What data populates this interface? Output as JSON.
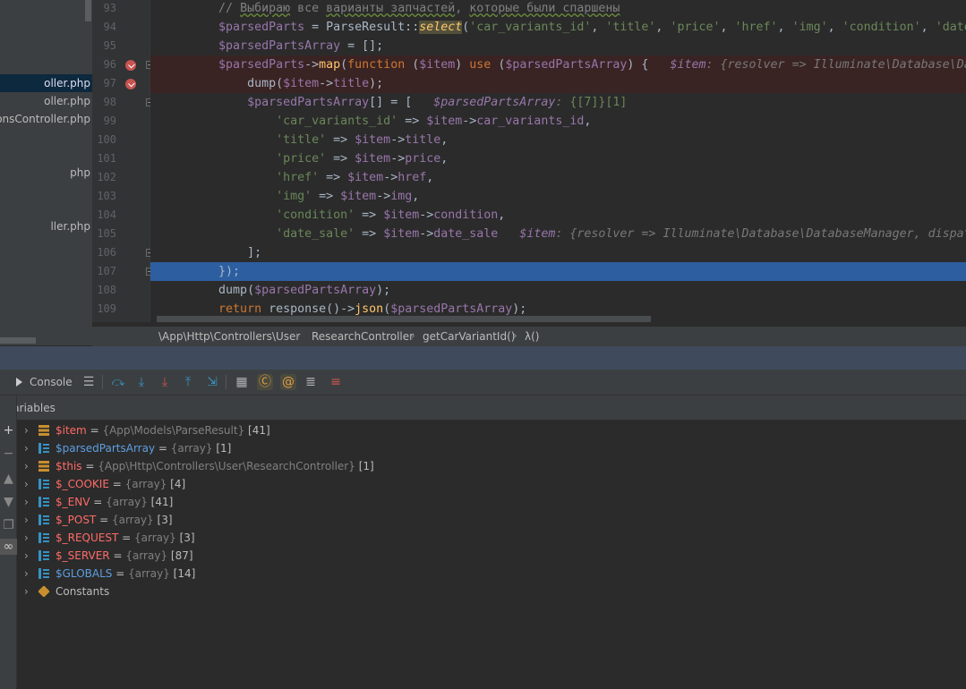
{
  "project_tree": {
    "items": [
      {
        "label": "oller.php",
        "selected": true
      },
      {
        "label": "oller.php",
        "selected": false
      },
      {
        "label": "ionsController.php",
        "selected": false
      },
      {
        "label": "php",
        "selected": false
      },
      {
        "label": "ller.php",
        "selected": false
      }
    ]
  },
  "editor": {
    "lines": [
      {
        "num": "93",
        "tokens": [
          [
            "c",
            "        // "
          ],
          [
            "c ru",
            "Выбираю"
          ],
          [
            "c",
            " все "
          ],
          [
            "c ru",
            "варианты запчастей"
          ],
          [
            "c",
            ", "
          ],
          [
            "c ru",
            "которые были спаршены"
          ]
        ]
      },
      {
        "num": "94",
        "tokens": [
          [
            "v",
            "        $parsedParts"
          ],
          [
            "cls",
            " = ParseResult::"
          ],
          [
            "sel",
            "select"
          ],
          [
            "cls",
            "("
          ],
          [
            "s",
            "'car_variants_id'"
          ],
          [
            "cls",
            ", "
          ],
          [
            "s",
            "'title'"
          ],
          [
            "cls",
            ", "
          ],
          [
            "s",
            "'price'"
          ],
          [
            "cls",
            ", "
          ],
          [
            "s",
            "'href'"
          ],
          [
            "cls",
            ", "
          ],
          [
            "s",
            "'img'"
          ],
          [
            "cls",
            ", "
          ],
          [
            "s",
            "'condition'"
          ],
          [
            "cls",
            ", "
          ],
          [
            "s",
            "'date_"
          ]
        ]
      },
      {
        "num": "95",
        "tokens": [
          [
            "v",
            "        $parsedPartsArray"
          ],
          [
            "cls",
            " = [];"
          ]
        ]
      },
      {
        "num": "96",
        "tokens": [
          [
            "v",
            "        $parsedParts"
          ],
          [
            "cls",
            "->"
          ],
          [
            "f",
            "map"
          ],
          [
            "cls",
            "("
          ],
          [
            "k",
            "function"
          ],
          [
            "cls",
            " ("
          ],
          [
            "v",
            "$item"
          ],
          [
            "cls",
            ") "
          ],
          [
            "k",
            "use"
          ],
          [
            "cls",
            " ("
          ],
          [
            "v",
            "$parsedPartsArray"
          ],
          [
            "cls",
            ") {   "
          ],
          [
            "hv",
            "$item"
          ],
          [
            "h",
            ": {resolver => Illuminate\\Database\\Dat"
          ]
        ]
      },
      {
        "num": "97",
        "tokens": [
          [
            "cls",
            "            dump("
          ],
          [
            "v",
            "$item"
          ],
          [
            "cls",
            "->"
          ],
          [
            "v",
            "title"
          ],
          [
            "cls",
            ");"
          ]
        ]
      },
      {
        "num": "98",
        "tokens": [
          [
            "v",
            "            $parsedPartsArray"
          ],
          [
            "cls",
            "[] = [   "
          ],
          [
            "hv",
            "$parsedPartsArray"
          ],
          [
            "h",
            ": "
          ],
          [
            "s",
            "{[7]}[1]"
          ]
        ]
      },
      {
        "num": "99",
        "tokens": [
          [
            "s",
            "                'car_variants_id'"
          ],
          [
            "cls",
            " => "
          ],
          [
            "v",
            "$item"
          ],
          [
            "cls",
            "->"
          ],
          [
            "v",
            "car_variants_id"
          ],
          [
            "cls",
            ","
          ]
        ]
      },
      {
        "num": "100",
        "tokens": [
          [
            "s",
            "                'title'"
          ],
          [
            "cls",
            " => "
          ],
          [
            "v",
            "$item"
          ],
          [
            "cls",
            "->"
          ],
          [
            "v",
            "title"
          ],
          [
            "cls",
            ","
          ]
        ]
      },
      {
        "num": "101",
        "tokens": [
          [
            "s",
            "                'price'"
          ],
          [
            "cls",
            " => "
          ],
          [
            "v",
            "$item"
          ],
          [
            "cls",
            "->"
          ],
          [
            "v",
            "price"
          ],
          [
            "cls",
            ","
          ]
        ]
      },
      {
        "num": "102",
        "tokens": [
          [
            "s",
            "                'href'"
          ],
          [
            "cls",
            " => "
          ],
          [
            "v",
            "$item"
          ],
          [
            "cls",
            "->"
          ],
          [
            "v",
            "href"
          ],
          [
            "cls",
            ","
          ]
        ]
      },
      {
        "num": "103",
        "tokens": [
          [
            "s",
            "                'img'"
          ],
          [
            "cls",
            " => "
          ],
          [
            "v",
            "$item"
          ],
          [
            "cls",
            "->"
          ],
          [
            "v",
            "img"
          ],
          [
            "cls",
            ","
          ]
        ]
      },
      {
        "num": "104",
        "tokens": [
          [
            "s",
            "                'condition'"
          ],
          [
            "cls",
            " => "
          ],
          [
            "v",
            "$item"
          ],
          [
            "cls",
            "->"
          ],
          [
            "v",
            "condition"
          ],
          [
            "cls",
            ","
          ]
        ]
      },
      {
        "num": "105",
        "tokens": [
          [
            "s",
            "                'date_sale'"
          ],
          [
            "cls",
            " => "
          ],
          [
            "v",
            "$item"
          ],
          [
            "cls",
            "->"
          ],
          [
            "v",
            "date_sale"
          ],
          [
            "cls",
            "   "
          ],
          [
            "hv",
            "$item"
          ],
          [
            "h",
            ": {resolver => Illuminate\\Database\\DatabaseManager, dispatc"
          ]
        ]
      },
      {
        "num": "106",
        "tokens": [
          [
            "cls",
            "            ];"
          ]
        ]
      },
      {
        "num": "107",
        "tokens": [
          [
            "cls",
            "        });"
          ]
        ]
      },
      {
        "num": "108",
        "tokens": [
          [
            "cls",
            "        dump("
          ],
          [
            "v",
            "$parsedPartsArray"
          ],
          [
            "cls",
            ");"
          ]
        ]
      },
      {
        "num": "109",
        "tokens": [
          [
            "k",
            "        return"
          ],
          [
            "cls",
            " response()->"
          ],
          [
            "f",
            "json"
          ],
          [
            "cls",
            "("
          ],
          [
            "v",
            "$parsedPartsArray"
          ],
          [
            "cls",
            ");"
          ]
        ]
      }
    ]
  },
  "breadcrumb": [
    "\\App\\Http\\Controllers\\User",
    "ResearchController",
    "getCarVariantId()",
    "λ()"
  ],
  "debug_toolbar": {
    "console_label": "Console"
  },
  "variables": {
    "header": "Variables",
    "rows": [
      {
        "name": "$item",
        "style": "red",
        "icon": "object",
        "type": "{App\\Models\\ParseResult}",
        "count": "[41]"
      },
      {
        "name": "$parsedPartsArray",
        "style": "blue",
        "icon": "array",
        "type": "{array}",
        "count": "[1]"
      },
      {
        "name": "$this",
        "style": "red",
        "icon": "object",
        "type": "{App\\Http\\Controllers\\User\\ResearchController}",
        "count": "[1]"
      },
      {
        "name": "$_COOKIE",
        "style": "red",
        "icon": "array",
        "type": "{array}",
        "count": "[4]"
      },
      {
        "name": "$_ENV",
        "style": "red",
        "icon": "array",
        "type": "{array}",
        "count": "[41]"
      },
      {
        "name": "$_POST",
        "style": "red",
        "icon": "array",
        "type": "{array}",
        "count": "[3]"
      },
      {
        "name": "$_REQUEST",
        "style": "red",
        "icon": "array",
        "type": "{array}",
        "count": "[3]"
      },
      {
        "name": "$_SERVER",
        "style": "red",
        "icon": "array",
        "type": "{array}",
        "count": "[87]"
      },
      {
        "name": "$GLOBALS",
        "style": "blue",
        "icon": "array",
        "type": "{array}",
        "count": "[14]"
      },
      {
        "name": "Constants",
        "style": "plain",
        "icon": "const",
        "type": "",
        "count": ""
      }
    ]
  }
}
